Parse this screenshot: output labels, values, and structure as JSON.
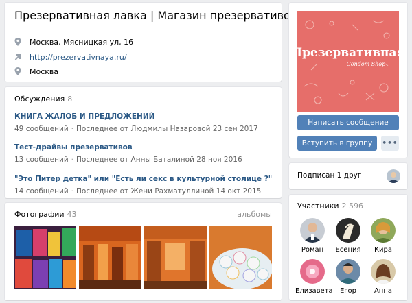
{
  "group": {
    "title": "Презервативная лавка | Магазин презервативов",
    "address": "Москва, Мясницкая ул, 16",
    "website": "http://prezervativnaya.ru/",
    "city": "Москва"
  },
  "discussions": {
    "label": "Обсуждения",
    "count": "8",
    "topics": [
      {
        "title": "КНИГА ЖАЛОБ И ПРЕДЛОЖЕНИЙ",
        "posts": "49 сообщений",
        "last": "Последнее от Людмилы Назаровой 23 сен 2017"
      },
      {
        "title": "Тест-драйвы презервативов",
        "posts": "13 сообщений",
        "last": "Последнее от Анны Баталиной 28 ноя 2016"
      },
      {
        "title": "\"Это Питер детка\" или \"Есть ли секс в культурной столице ?\"",
        "posts": "14 сообщений",
        "last": "Последнее от Жени Рахматуллиной 14 окт 2015"
      }
    ]
  },
  "photos": {
    "label": "Фотографии",
    "count": "43",
    "albums_link": "альбомы"
  },
  "avatar": {
    "logo_text": "Презервативная",
    "script_text": "Condom Shop",
    "bg_color": "#e66e6a"
  },
  "actions": {
    "message": "Написать сообщение",
    "join": "Вступить в группу",
    "more": "•••"
  },
  "friends": {
    "label": "Подписан 1 друг"
  },
  "members": {
    "label": "Участники",
    "count": "2 596",
    "list": [
      {
        "name": "Роман"
      },
      {
        "name": "Есения"
      },
      {
        "name": "Кира"
      },
      {
        "name": "Елизавета"
      },
      {
        "name": "Егор"
      },
      {
        "name": "Анна"
      }
    ]
  },
  "colors": {
    "link": "#2a5885",
    "button": "#5181b8",
    "page_bg": "#edeef0"
  },
  "icons": [
    "map-pin-icon",
    "link-arrow-icon",
    "location-pin-icon",
    "more-dots-icon"
  ]
}
